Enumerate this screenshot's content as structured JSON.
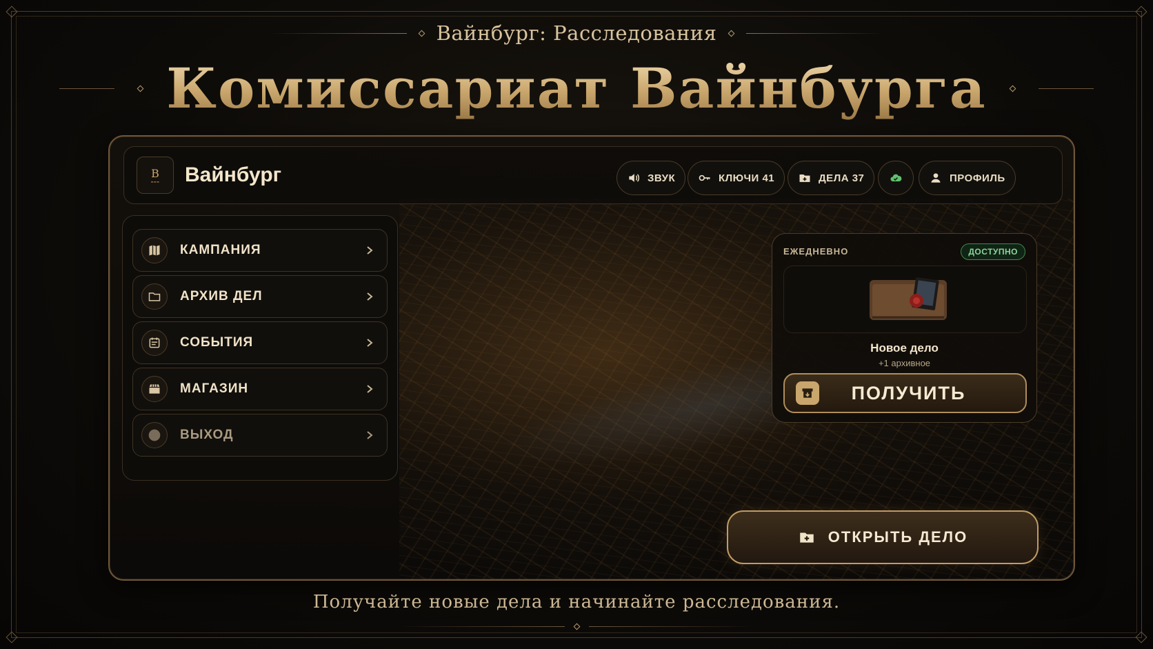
{
  "header": {
    "subtitle": "Вайнбург: Расследования",
    "title": "Комиссариат Вайнбурга"
  },
  "topbar": {
    "logo_letter": "B",
    "brand": "Вайнбург",
    "sound_label": "ЗВУК",
    "keys_label": "КЛЮЧИ 41",
    "cases_label": "ДЕЛА 37",
    "profile_label": "ПРОФИЛЬ"
  },
  "menu": {
    "items": [
      {
        "label": "КАМПАНИЯ",
        "icon": "map-icon"
      },
      {
        "label": "АРХИВ ДЕЛ",
        "icon": "folder-icon"
      },
      {
        "label": "СОБЫТИЯ",
        "icon": "calendar-icon"
      },
      {
        "label": "МАГАЗИН",
        "icon": "shop-icon"
      },
      {
        "label": "ВЫХОД",
        "icon": "exit-icon"
      }
    ]
  },
  "daily": {
    "header": "ЕЖЕДНЕВНО",
    "badge": "ДОСТУПНО",
    "case_name": "Новое дело",
    "case_sub": "+1 архивное",
    "button": "ПОЛУЧИТЬ"
  },
  "actions": {
    "open_case": "ОТКРЫТЬ ДЕЛО"
  },
  "footer": {
    "text": "Получайте новые дела и начинайте расследования."
  },
  "colors": {
    "accent_gold": "#c9a66c",
    "available_green": "#8fd39a",
    "background": "#0e0c09"
  }
}
